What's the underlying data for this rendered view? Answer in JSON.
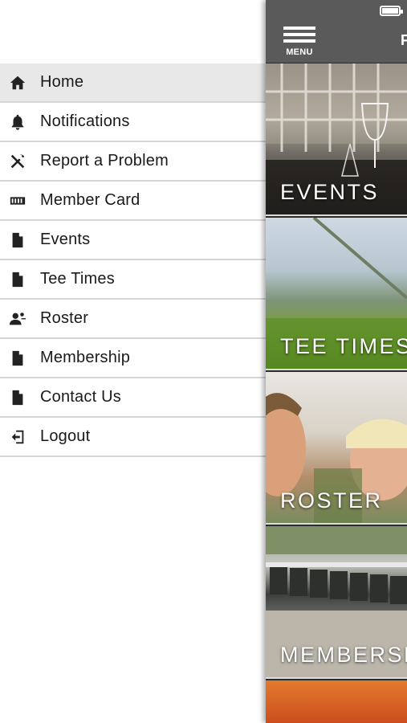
{
  "drawer": {
    "items": [
      {
        "label": "Home",
        "icon": "home-icon",
        "active": true
      },
      {
        "label": "Notifications",
        "icon": "bell-icon",
        "active": false
      },
      {
        "label": "Report a Problem",
        "icon": "tools-icon",
        "active": false
      },
      {
        "label": "Member Card",
        "icon": "card-icon",
        "active": false
      },
      {
        "label": "Events",
        "icon": "document-icon",
        "active": false
      },
      {
        "label": "Tee Times",
        "icon": "document-icon",
        "active": false
      },
      {
        "label": "Roster",
        "icon": "people-icon",
        "active": false
      },
      {
        "label": "Membership",
        "icon": "document-icon",
        "active": false
      },
      {
        "label": "Contact Us",
        "icon": "document-icon",
        "active": false
      },
      {
        "label": "Logout",
        "icon": "logout-icon",
        "active": false
      }
    ]
  },
  "main": {
    "menu_label": "MENU",
    "title_fragment": "F",
    "tiles": [
      {
        "caption": "EVENTS"
      },
      {
        "caption": "TEE TIMES"
      },
      {
        "caption": "ROSTER"
      },
      {
        "caption": "MEMBERSHIP"
      }
    ]
  },
  "colors": {
    "topbar": "#5a5a5a",
    "active_item": "#e8e8e8",
    "divider": "#d6d6d6"
  }
}
